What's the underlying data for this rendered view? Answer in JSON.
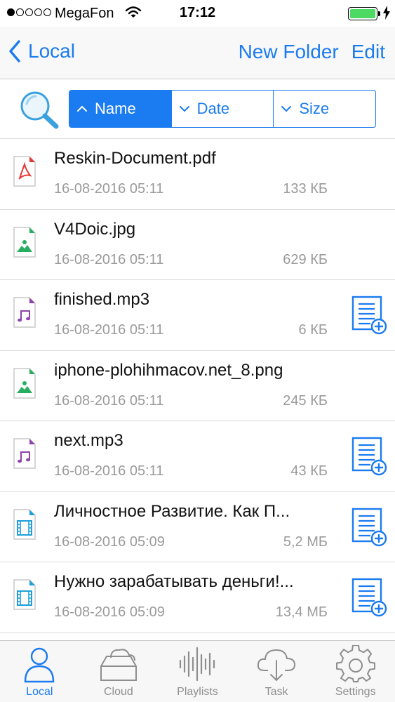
{
  "status_bar": {
    "carrier": "MegaFon",
    "time": "17:12"
  },
  "nav": {
    "back_label": "Local",
    "new_folder_label": "New Folder",
    "edit_label": "Edit"
  },
  "sort": {
    "options": [
      {
        "label": "Name",
        "active": true,
        "direction": "up"
      },
      {
        "label": "Date",
        "active": false,
        "direction": "down"
      },
      {
        "label": "Size",
        "active": false,
        "direction": "down"
      }
    ]
  },
  "files": [
    {
      "name": "Reskin-Document.pdf",
      "date": "16-08-2016 05:11",
      "size": "133 КБ",
      "icon": "pdf-file-icon",
      "playlist": false
    },
    {
      "name": "V4Doic.jpg",
      "date": "16-08-2016 05:11",
      "size": "629 КБ",
      "icon": "image-file-icon",
      "playlist": false
    },
    {
      "name": "finished.mp3",
      "date": "16-08-2016 05:11",
      "size": "6 КБ",
      "icon": "audio-file-icon",
      "playlist": true
    },
    {
      "name": "iphone-plohihmacov.net_8.png",
      "date": "16-08-2016 05:11",
      "size": "245 КБ",
      "icon": "image-file-icon",
      "playlist": false
    },
    {
      "name": "next.mp3",
      "date": "16-08-2016 05:11",
      "size": "43 КБ",
      "icon": "audio-file-icon",
      "playlist": true
    },
    {
      "name": "Личностное Развитие. Как П...",
      "date": "16-08-2016 05:09",
      "size": "5,2 МБ",
      "icon": "video-file-icon",
      "playlist": true
    },
    {
      "name": "Нужно зарабатывать деньги!...",
      "date": "16-08-2016 05:09",
      "size": "13,4 МБ",
      "icon": "video-file-icon",
      "playlist": true
    }
  ],
  "tabs": [
    {
      "label": "Local",
      "icon": "person-icon",
      "active": true
    },
    {
      "label": "Cloud",
      "icon": "cloud-drive-icon",
      "active": false
    },
    {
      "label": "Playlists",
      "icon": "waveform-icon",
      "active": false
    },
    {
      "label": "Task",
      "icon": "cloud-download-icon",
      "active": false
    },
    {
      "label": "Settings",
      "icon": "gear-icon",
      "active": false
    }
  ],
  "colors": {
    "accent": "#1b7bf0",
    "pdf": "#e53935",
    "image": "#27ae60",
    "audio": "#8e44ad",
    "video": "#1ea0d8",
    "muted": "#9a9a9a"
  }
}
